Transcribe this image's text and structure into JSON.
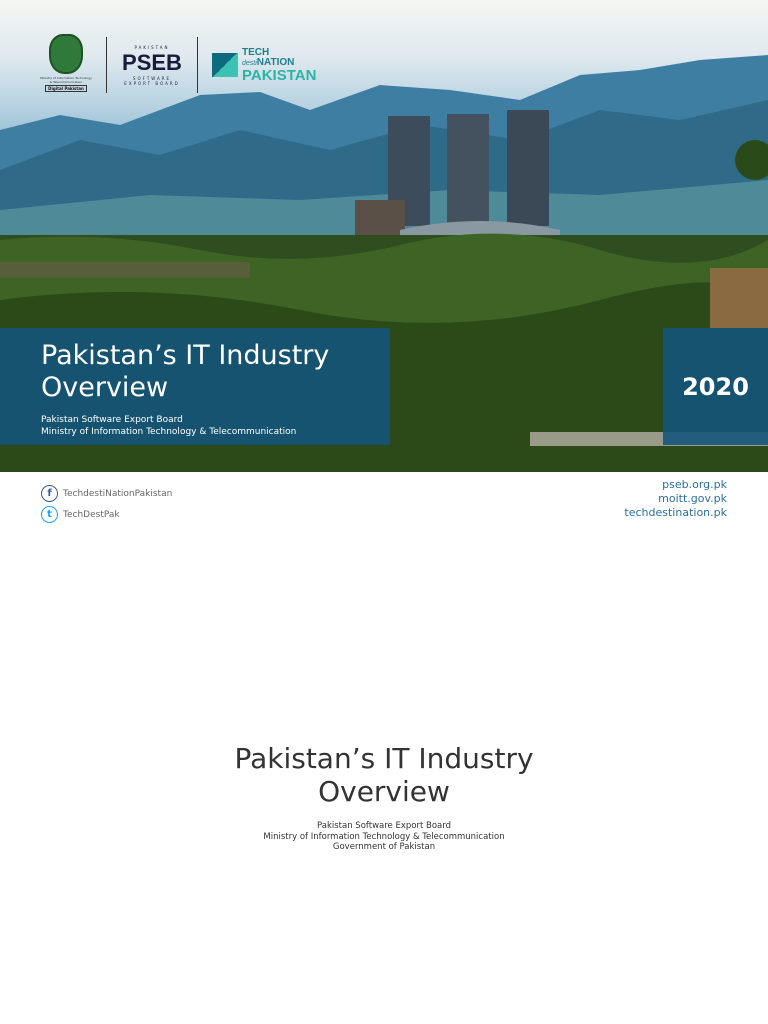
{
  "logos": {
    "ministry_caption": "Ministry of Information Technology & Telecommunication",
    "ministry_tag": "Digital Pakistan",
    "pseb_top": "PAKISTAN",
    "pseb_name": "PSEB",
    "pseb_bottom": "SOFTWARE EXPORT BOARD",
    "tech_line1": "TECH",
    "tech_desti": "desti",
    "tech_line2": "NATION",
    "tech_line3": "PAKISTAN"
  },
  "banner": {
    "title_line1": "Pakistan’s IT Industry",
    "title_line2": "Overview",
    "org1": "Pakistan Software Export Board",
    "org2": "Ministry of Information Technology & Telecommunication",
    "year": "2020"
  },
  "social": [
    {
      "icon": "facebook-icon",
      "glyph": "f",
      "handle": "TechdestiNationPakistan"
    },
    {
      "icon": "twitter-icon",
      "glyph": "t",
      "handle": "TechDestPak"
    }
  ],
  "links": [
    "pseb.org.pk",
    "moitt.gov.pk",
    "techdestination.pk"
  ],
  "main": {
    "title_line1": "Pakistan’s IT Industry",
    "title_line2": "Overview",
    "line1": "Pakistan Software Export Board",
    "line2": "Ministry of Information Technology & Telecommunication",
    "line3": "Government of Pakistan"
  }
}
